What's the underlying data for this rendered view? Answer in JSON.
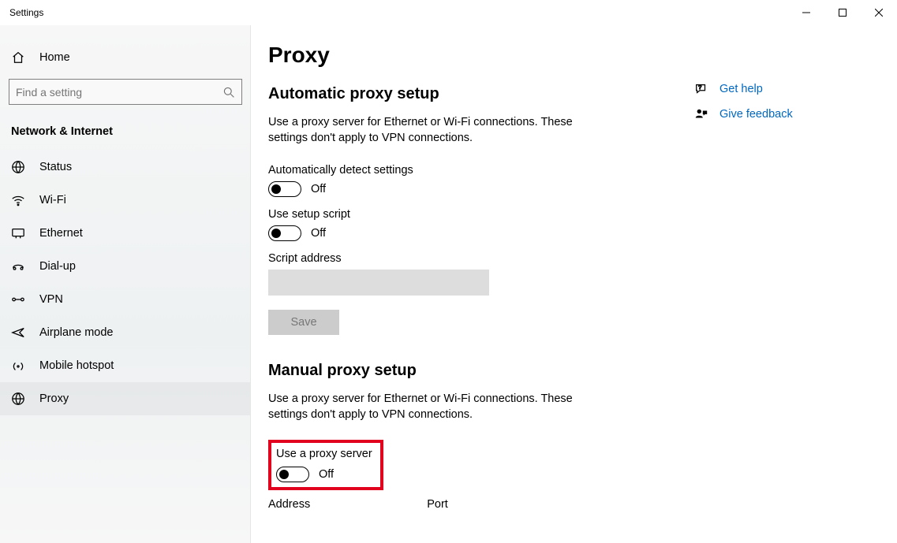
{
  "window": {
    "title": "Settings"
  },
  "sidebar": {
    "home_label": "Home",
    "search_placeholder": "Find a setting",
    "category_title": "Network & Internet",
    "items": [
      {
        "label": "Status"
      },
      {
        "label": "Wi-Fi"
      },
      {
        "label": "Ethernet"
      },
      {
        "label": "Dial-up"
      },
      {
        "label": "VPN"
      },
      {
        "label": "Airplane mode"
      },
      {
        "label": "Mobile hotspot"
      },
      {
        "label": "Proxy"
      }
    ]
  },
  "page": {
    "title": "Proxy",
    "auto": {
      "section_title": "Automatic proxy setup",
      "desc": "Use a proxy server for Ethernet or Wi-Fi connections. These settings don't apply to VPN connections.",
      "auto_detect_label": "Automatically detect settings",
      "auto_detect_state": "Off",
      "use_script_label": "Use setup script",
      "use_script_state": "Off",
      "script_address_label": "Script address",
      "script_address_value": "",
      "save_label": "Save"
    },
    "manual": {
      "section_title": "Manual proxy setup",
      "desc": "Use a proxy server for Ethernet or Wi-Fi connections. These settings don't apply to VPN connections.",
      "use_proxy_label": "Use a proxy server",
      "use_proxy_state": "Off",
      "address_label": "Address",
      "port_label": "Port"
    }
  },
  "help": {
    "get_help": "Get help",
    "give_feedback": "Give feedback"
  }
}
